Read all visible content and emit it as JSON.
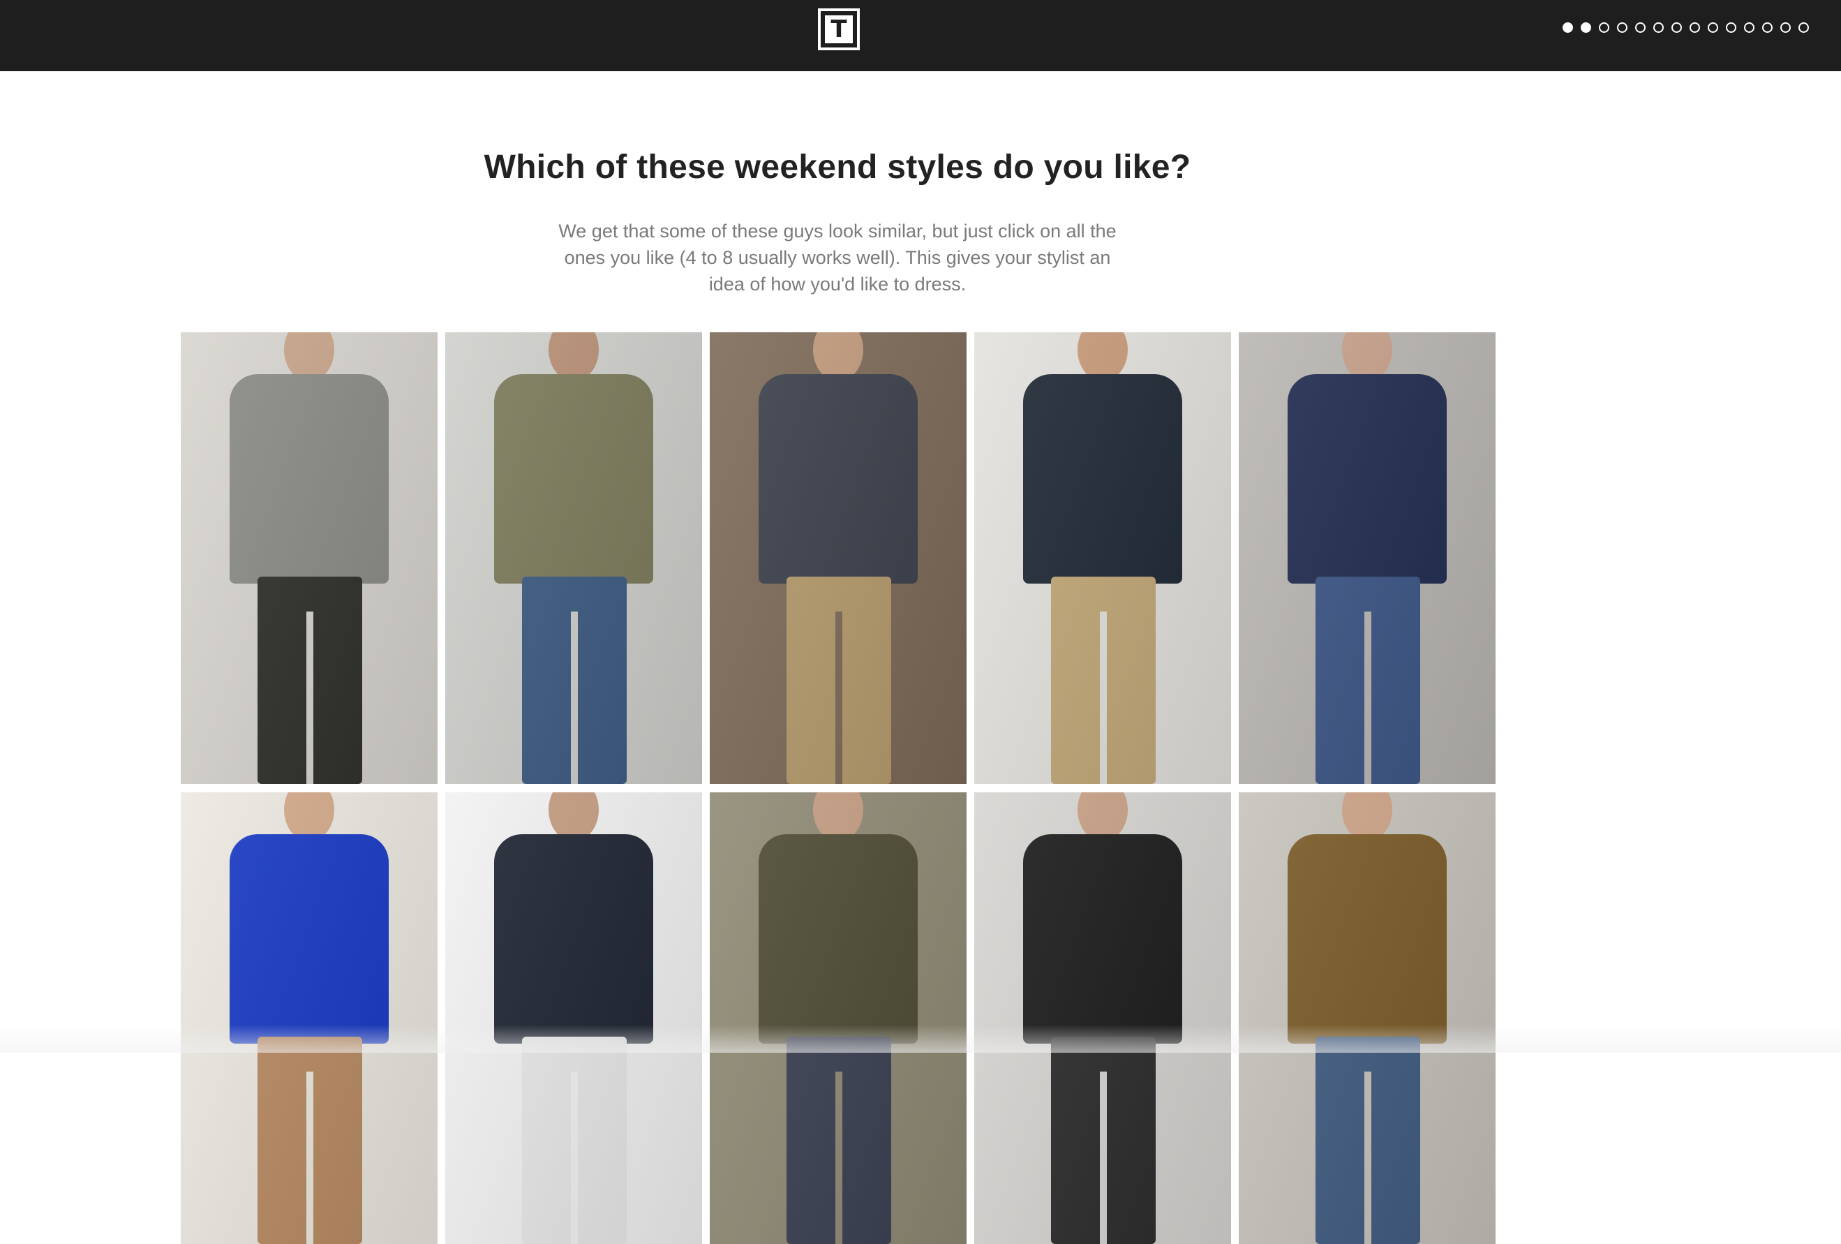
{
  "header": {
    "logo_letter": "T",
    "progress": {
      "total_steps": 14,
      "completed_steps": 2
    }
  },
  "main": {
    "title": "Which of these weekend styles do you like?",
    "subtitle": "We get that some of these guys look similar, but just click on all the ones you like (4 to 8 usually works well). This gives your stylist an idea of how you'd like to dress."
  },
  "styles": [
    {
      "name": "grey-sweater-cargo-pants",
      "bg": "#d8d5cf",
      "top": "#8a8a86",
      "bottom": "#2e2e2a",
      "skin": "#c9a58a"
    },
    {
      "name": "olive-parka-ripped-jeans",
      "bg": "#cfd0cc",
      "top": "#7c7a5a",
      "bottom": "#3c5a82",
      "skin": "#b98f74"
    },
    {
      "name": "puffer-vest-bicycle",
      "bg": "#7d6a58",
      "top": "#3a3f4a",
      "bottom": "#b59a6c",
      "skin": "#c29a7c"
    },
    {
      "name": "tank-top-chino-shorts",
      "bg": "#e4e2de",
      "top": "#1d2733",
      "bottom": "#c2a877",
      "skin": "#c89a78"
    },
    {
      "name": "navy-peacoat-knit",
      "bg": "#b9b6b2",
      "top": "#1f2a4e",
      "bottom": "#3b5586",
      "skin": "#c6a08a"
    },
    {
      "name": "blue-polo",
      "bg": "#ece8e1",
      "top": "#1638c4",
      "bottom": "#b98a62",
      "skin": "#d4a988"
    },
    {
      "name": "black-windbreaker",
      "bg": "#f2f2f2",
      "top": "#1c2230",
      "bottom": "#e8e8e8",
      "skin": "#c49c80"
    },
    {
      "name": "olive-peacoat",
      "bg": "#8f8a74",
      "top": "#4d4a32",
      "bottom": "#3a3f52",
      "skin": "#c59d82"
    },
    {
      "name": "black-leather-jacket",
      "bg": "#d7d5d2",
      "top": "#1a1a1a",
      "bottom": "#2b2b2b",
      "skin": "#c8a085"
    },
    {
      "name": "corduroy-sherpa-jacket",
      "bg": "#c6c2bb",
      "top": "#7a5a26",
      "bottom": "#3f5a80",
      "skin": "#cda386"
    }
  ]
}
